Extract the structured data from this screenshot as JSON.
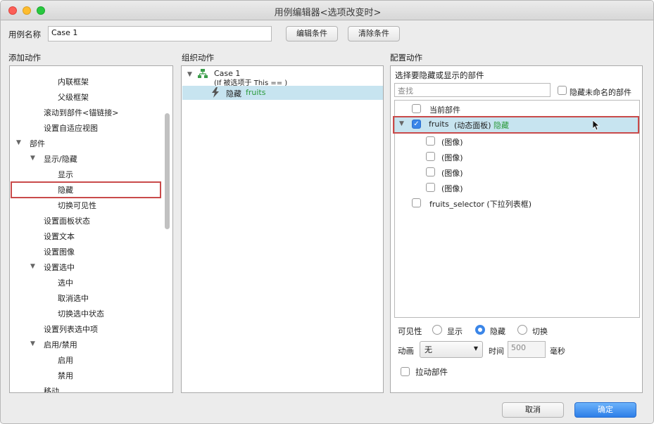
{
  "window": {
    "title": "用例编辑器<选项改变时>"
  },
  "header": {
    "case_name_label": "用例名称",
    "case_name_value": "Case 1",
    "edit_conditions_button": "编辑条件",
    "clear_conditions_button": "清除条件"
  },
  "sections": {
    "add_action": "添加动作",
    "organize_action": "组织动作",
    "configure_action": "配置动作"
  },
  "add_action_tree": [
    {
      "label": "内联框架"
    },
    {
      "label": "父级框架"
    },
    {
      "label": "滚动到部件<锚链接>"
    },
    {
      "label": "设置自适应视图"
    },
    {
      "label": "部件"
    },
    {
      "label": "显示/隐藏"
    },
    {
      "label": "显示"
    },
    {
      "label": "隐藏"
    },
    {
      "label": "切换可见性"
    },
    {
      "label": "设置面板状态"
    },
    {
      "label": "设置文本"
    },
    {
      "label": "设置图像"
    },
    {
      "label": "设置选中"
    },
    {
      "label": "选中"
    },
    {
      "label": "取消选中"
    },
    {
      "label": "切换选中状态"
    },
    {
      "label": "设置列表选中项"
    },
    {
      "label": "启用/禁用"
    },
    {
      "label": "启用"
    },
    {
      "label": "禁用"
    },
    {
      "label": "移动"
    }
  ],
  "organize": {
    "case_label": "Case 1",
    "case_condition": "(If 被选项于 This == )",
    "action_prefix": "隐藏",
    "action_target": "fruits"
  },
  "configure": {
    "subtitle": "选择要隐藏或显示的部件",
    "search_placeholder": "查找",
    "hide_unnamed_label": "隐藏未命名的部件",
    "widgets": [
      {
        "label": "当前部件"
      },
      {
        "name": "fruits",
        "type": "(动态面板)",
        "action": "隐藏"
      },
      {
        "label": "(图像)"
      },
      {
        "label": "(图像)"
      },
      {
        "label": "(图像)"
      },
      {
        "label": "(图像)"
      },
      {
        "label": "fruits_selector (下拉列表框)"
      }
    ],
    "visibility_label": "可见性",
    "visibility_options": [
      "显示",
      "隐藏",
      "切换"
    ],
    "animation_label": "动画",
    "animation_value": "无",
    "time_label": "时间",
    "time_value": "500",
    "ms_label": "毫秒",
    "drag_widget_label": "拉动部件"
  },
  "footer": {
    "cancel_button": "取消",
    "ok_button": "确定"
  },
  "colors": {
    "highlight": "#c7e4f0",
    "checked": "#3b86e8",
    "action_green": "#2a9a3a",
    "annotation_red": "#c94a4a"
  }
}
